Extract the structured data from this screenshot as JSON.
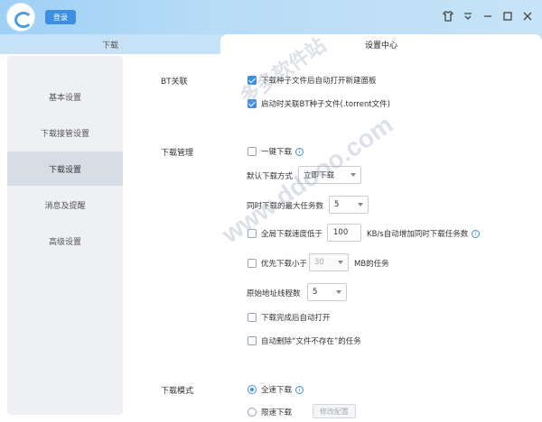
{
  "header": {
    "login_label": "登录"
  },
  "tabs": {
    "download": "下载",
    "settings": "设置中心"
  },
  "sidebar": {
    "items": [
      {
        "label": "基本设置"
      },
      {
        "label": "下载接管设置"
      },
      {
        "label": "下载设置"
      },
      {
        "label": "消息及提醒"
      },
      {
        "label": "高级设置"
      }
    ],
    "active_index": 2
  },
  "bt": {
    "label": "BT关联",
    "opt1": "下载种子文件后自动打开新建面板",
    "opt2": "启动时关联BT种子文件(.torrent文件)"
  },
  "manage": {
    "label": "下载管理",
    "one_click": "一键下载",
    "default_mode_label": "默认下载方式",
    "default_mode_value": "立即下载",
    "max_tasks_label": "同时下载的最大任务数",
    "max_tasks_value": "5",
    "low_speed_label": "全局下载速度低于",
    "low_speed_value": "100",
    "low_speed_suffix": "KB/s自动增加同时下载任务数",
    "priority_label": "优先下载小于",
    "priority_value": "30",
    "priority_suffix": "MB的任务",
    "threads_label": "原始地址线程数",
    "threads_value": "5",
    "auto_open": "下载完成后自动打开",
    "auto_delete": "自动删除“文件不存在”的任务"
  },
  "mode": {
    "label": "下载模式",
    "full_speed": "全速下载",
    "limited": "限速下载",
    "config_btn": "修改配置"
  },
  "watermark": {
    "text1": "多多软件站",
    "text2": "www.ddooo.com"
  }
}
